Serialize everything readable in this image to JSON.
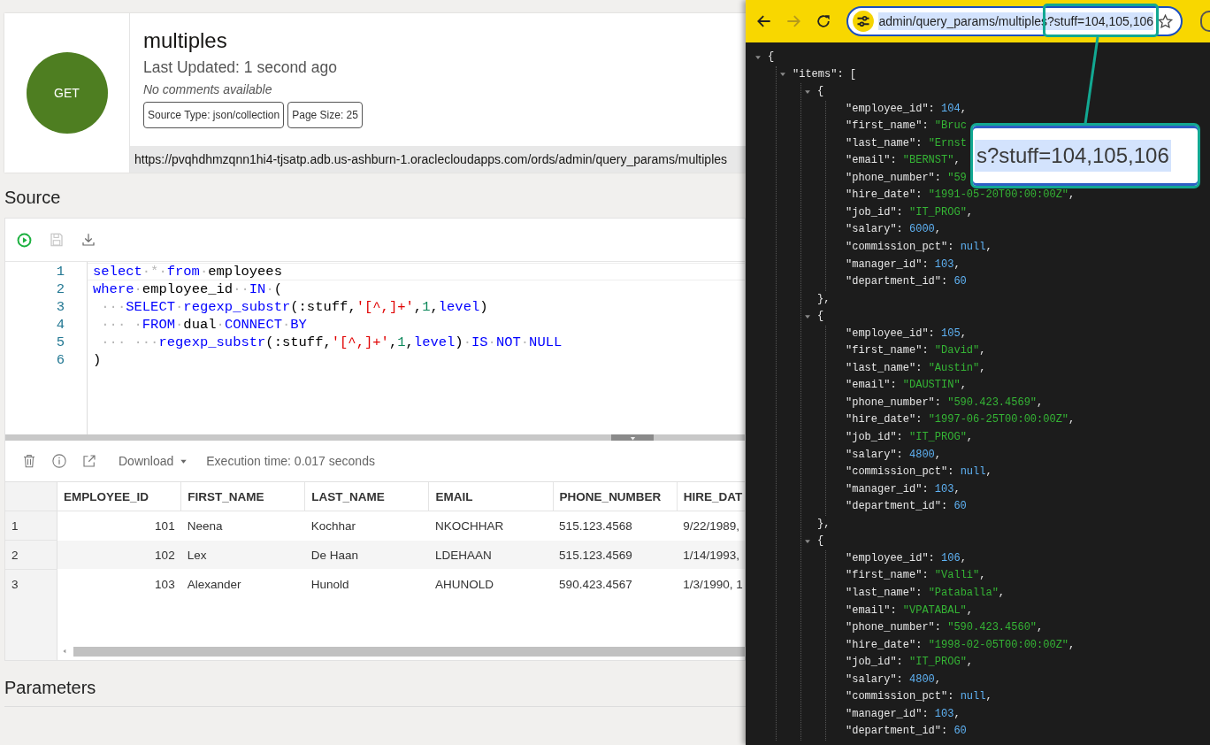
{
  "resource": {
    "method": "GET",
    "title": "multiples",
    "last_updated": "Last Updated: 1 second ago",
    "comments": "No comments available",
    "tags": [
      "Source Type: json/collection",
      "Page Size: 25"
    ],
    "url": "https://pvqhdhmzqnn1hi4-tjsatp.adb.us-ashburn-1.oraclecloudapps.com/ords/admin/query_params/multiples"
  },
  "source": {
    "heading": "Source",
    "toolbar": [
      {
        "kind": "run",
        "disabled": false
      },
      {
        "kind": "save",
        "disabled": true
      },
      {
        "kind": "download",
        "disabled": false
      }
    ],
    "lines": [
      {
        "number": "1",
        "tokens": [
          {
            "kind": "kw",
            "text": "select"
          },
          {
            "kind": "ws",
            "text": "·*·"
          },
          {
            "kind": "kw",
            "text": "from"
          },
          {
            "kind": "ws",
            "text": "·"
          },
          {
            "kind": "plain",
            "text": "employees"
          }
        ]
      },
      {
        "number": "2",
        "tokens": [
          {
            "kind": "kw",
            "text": "where"
          },
          {
            "kind": "ws",
            "text": "·"
          },
          {
            "kind": "plain",
            "text": "employee_id"
          },
          {
            "kind": "ws",
            "text": "··"
          },
          {
            "kind": "kw",
            "text": "IN"
          },
          {
            "kind": "ws",
            "text": "·"
          },
          {
            "kind": "plain",
            "text": "("
          }
        ]
      },
      {
        "number": "3",
        "tokens": [
          {
            "kind": "ws",
            "text": " ···"
          },
          {
            "kind": "kw",
            "text": "SELECT"
          },
          {
            "kind": "ws",
            "text": "·"
          },
          {
            "kind": "kw",
            "text": "regexp_substr"
          },
          {
            "kind": "plain",
            "text": "(:stuff,"
          },
          {
            "kind": "str",
            "text": "'[^,]+'"
          },
          {
            "kind": "plain",
            "text": ","
          },
          {
            "kind": "num",
            "text": "1"
          },
          {
            "kind": "plain",
            "text": ","
          },
          {
            "kind": "kw",
            "text": "level"
          },
          {
            "kind": "plain",
            "text": ")"
          }
        ]
      },
      {
        "number": "4",
        "tokens": [
          {
            "kind": "ws",
            "text": " ··· ·"
          },
          {
            "kind": "kw",
            "text": "FROM"
          },
          {
            "kind": "ws",
            "text": "·"
          },
          {
            "kind": "plain",
            "text": "dual"
          },
          {
            "kind": "ws",
            "text": "·"
          },
          {
            "kind": "kw",
            "text": "CONNECT"
          },
          {
            "kind": "ws",
            "text": "·"
          },
          {
            "kind": "kw",
            "text": "BY"
          }
        ]
      },
      {
        "number": "5",
        "tokens": [
          {
            "kind": "ws",
            "text": " ··· ···"
          },
          {
            "kind": "kw",
            "text": "regexp_substr"
          },
          {
            "kind": "plain",
            "text": "(:stuff,"
          },
          {
            "kind": "str",
            "text": "'[^,]+'"
          },
          {
            "kind": "plain",
            "text": ","
          },
          {
            "kind": "num",
            "text": "1"
          },
          {
            "kind": "plain",
            "text": ","
          },
          {
            "kind": "kw",
            "text": "level"
          },
          {
            "kind": "plain",
            "text": ")"
          },
          {
            "kind": "ws",
            "text": "·"
          },
          {
            "kind": "kw",
            "text": "IS"
          },
          {
            "kind": "ws",
            "text": "·"
          },
          {
            "kind": "kw",
            "text": "NOT"
          },
          {
            "kind": "ws",
            "text": "·"
          },
          {
            "kind": "kw",
            "text": "NULL"
          }
        ]
      },
      {
        "number": "6",
        "tokens": [
          {
            "kind": "plain",
            "text": ")"
          }
        ]
      }
    ]
  },
  "results": {
    "toolbar": [
      {
        "kind": "delete"
      },
      {
        "kind": "info"
      },
      {
        "kind": "open-external"
      }
    ],
    "download": "Download",
    "execution_time": "Execution time: 0.017 seconds",
    "columns": [
      "EMPLOYEE_ID",
      "FIRST_NAME",
      "LAST_NAME",
      "EMAIL",
      "PHONE_NUMBER",
      "HIRE_DAT"
    ],
    "rows": [
      {
        "number": "1",
        "cells": [
          "101",
          "Neena",
          "Kochhar",
          "NKOCHHAR",
          "515.123.4568",
          "9/22/1989,"
        ]
      },
      {
        "number": "2",
        "cells": [
          "102",
          "Lex",
          "De Haan",
          "LDEHAAN",
          "515.123.4569",
          "1/14/1993,"
        ]
      },
      {
        "number": "3",
        "cells": [
          "103",
          "Alexander",
          "Hunold",
          "AHUNOLD",
          "590.423.4567",
          "1/3/1990, 1"
        ]
      }
    ]
  },
  "parameters": {
    "heading": "Parameters"
  },
  "browser": {
    "nav": [
      {
        "kind": "back",
        "disabled": false
      },
      {
        "kind": "forward",
        "disabled": true
      },
      {
        "kind": "reload",
        "disabled": false
      }
    ],
    "address": "admin/query_params/multiples?stuff=104,105,106",
    "callout": "s?stuff=104,105,106",
    "viewer": {
      "open": "{",
      "expanded": true,
      "children": [
        {
          "key": "\"items\":",
          "open": "[",
          "expanded": true,
          "children": [
            {
              "open": "{",
              "expanded": true,
              "close": "},",
              "fields": [
                {
                  "key": "\"employee_id\":",
                  "value": "104",
                  "kind": "number",
                  "tail": ","
                },
                {
                  "key": "\"first_name\":",
                  "value": "\"Bruc",
                  "kind": "string"
                },
                {
                  "key": "\"last_name\":",
                  "value": "\"Ernst",
                  "kind": "string"
                },
                {
                  "key": "\"email\":",
                  "value": "\"BERNST\"",
                  "kind": "string",
                  "tail": ","
                },
                {
                  "key": "\"phone_number\":",
                  "value": "\"59",
                  "kind": "string"
                },
                {
                  "key": "\"hire_date\":",
                  "value": "\"1991-05-20T00:00:00Z\"",
                  "kind": "string",
                  "tail": ","
                },
                {
                  "key": "\"job_id\":",
                  "value": "\"IT_PROG\"",
                  "kind": "string",
                  "tail": ","
                },
                {
                  "key": "\"salary\":",
                  "value": "6000",
                  "kind": "number",
                  "tail": ","
                },
                {
                  "key": "\"commission_pct\":",
                  "value": "null",
                  "kind": "null",
                  "tail": ","
                },
                {
                  "key": "\"manager_id\":",
                  "value": "103",
                  "kind": "number",
                  "tail": ","
                },
                {
                  "key": "\"department_id\":",
                  "value": "60",
                  "kind": "number"
                }
              ]
            },
            {
              "open": "{",
              "expanded": true,
              "close": "},",
              "fields": [
                {
                  "key": "\"employee_id\":",
                  "value": "105",
                  "kind": "number",
                  "tail": ","
                },
                {
                  "key": "\"first_name\":",
                  "value": "\"David\"",
                  "kind": "string",
                  "tail": ","
                },
                {
                  "key": "\"last_name\":",
                  "value": "\"Austin\"",
                  "kind": "string",
                  "tail": ","
                },
                {
                  "key": "\"email\":",
                  "value": "\"DAUSTIN\"",
                  "kind": "string",
                  "tail": ","
                },
                {
                  "key": "\"phone_number\":",
                  "value": "\"590.423.4569\"",
                  "kind": "string",
                  "tail": ","
                },
                {
                  "key": "\"hire_date\":",
                  "value": "\"1997-06-25T00:00:00Z\"",
                  "kind": "string",
                  "tail": ","
                },
                {
                  "key": "\"job_id\":",
                  "value": "\"IT_PROG\"",
                  "kind": "string",
                  "tail": ","
                },
                {
                  "key": "\"salary\":",
                  "value": "4800",
                  "kind": "number",
                  "tail": ","
                },
                {
                  "key": "\"commission_pct\":",
                  "value": "null",
                  "kind": "null",
                  "tail": ","
                },
                {
                  "key": "\"manager_id\":",
                  "value": "103",
                  "kind": "number",
                  "tail": ","
                },
                {
                  "key": "\"department_id\":",
                  "value": "60",
                  "kind": "number"
                }
              ]
            },
            {
              "open": "{",
              "expanded": true,
              "fields": [
                {
                  "key": "\"employee_id\":",
                  "value": "106",
                  "kind": "number",
                  "tail": ","
                },
                {
                  "key": "\"first_name\":",
                  "value": "\"Valli\"",
                  "kind": "string",
                  "tail": ","
                },
                {
                  "key": "\"last_name\":",
                  "value": "\"Pataballa\"",
                  "kind": "string",
                  "tail": ","
                },
                {
                  "key": "\"email\":",
                  "value": "\"VPATABAL\"",
                  "kind": "string",
                  "tail": ","
                },
                {
                  "key": "\"phone_number\":",
                  "value": "\"590.423.4560\"",
                  "kind": "string",
                  "tail": ","
                },
                {
                  "key": "\"hire_date\":",
                  "value": "\"1998-02-05T00:00:00Z\"",
                  "kind": "string",
                  "tail": ","
                },
                {
                  "key": "\"job_id\":",
                  "value": "\"IT_PROG\"",
                  "kind": "string",
                  "tail": ","
                },
                {
                  "key": "\"salary\":",
                  "value": "4800",
                  "kind": "number",
                  "tail": ","
                },
                {
                  "key": "\"commission_pct\":",
                  "value": "null",
                  "kind": "null",
                  "tail": ","
                },
                {
                  "key": "\"manager_id\":",
                  "value": "103",
                  "kind": "number",
                  "tail": ","
                },
                {
                  "key": "\"department_id\":",
                  "value": "60",
                  "kind": "number"
                }
              ]
            }
          ]
        }
      ]
    }
  }
}
